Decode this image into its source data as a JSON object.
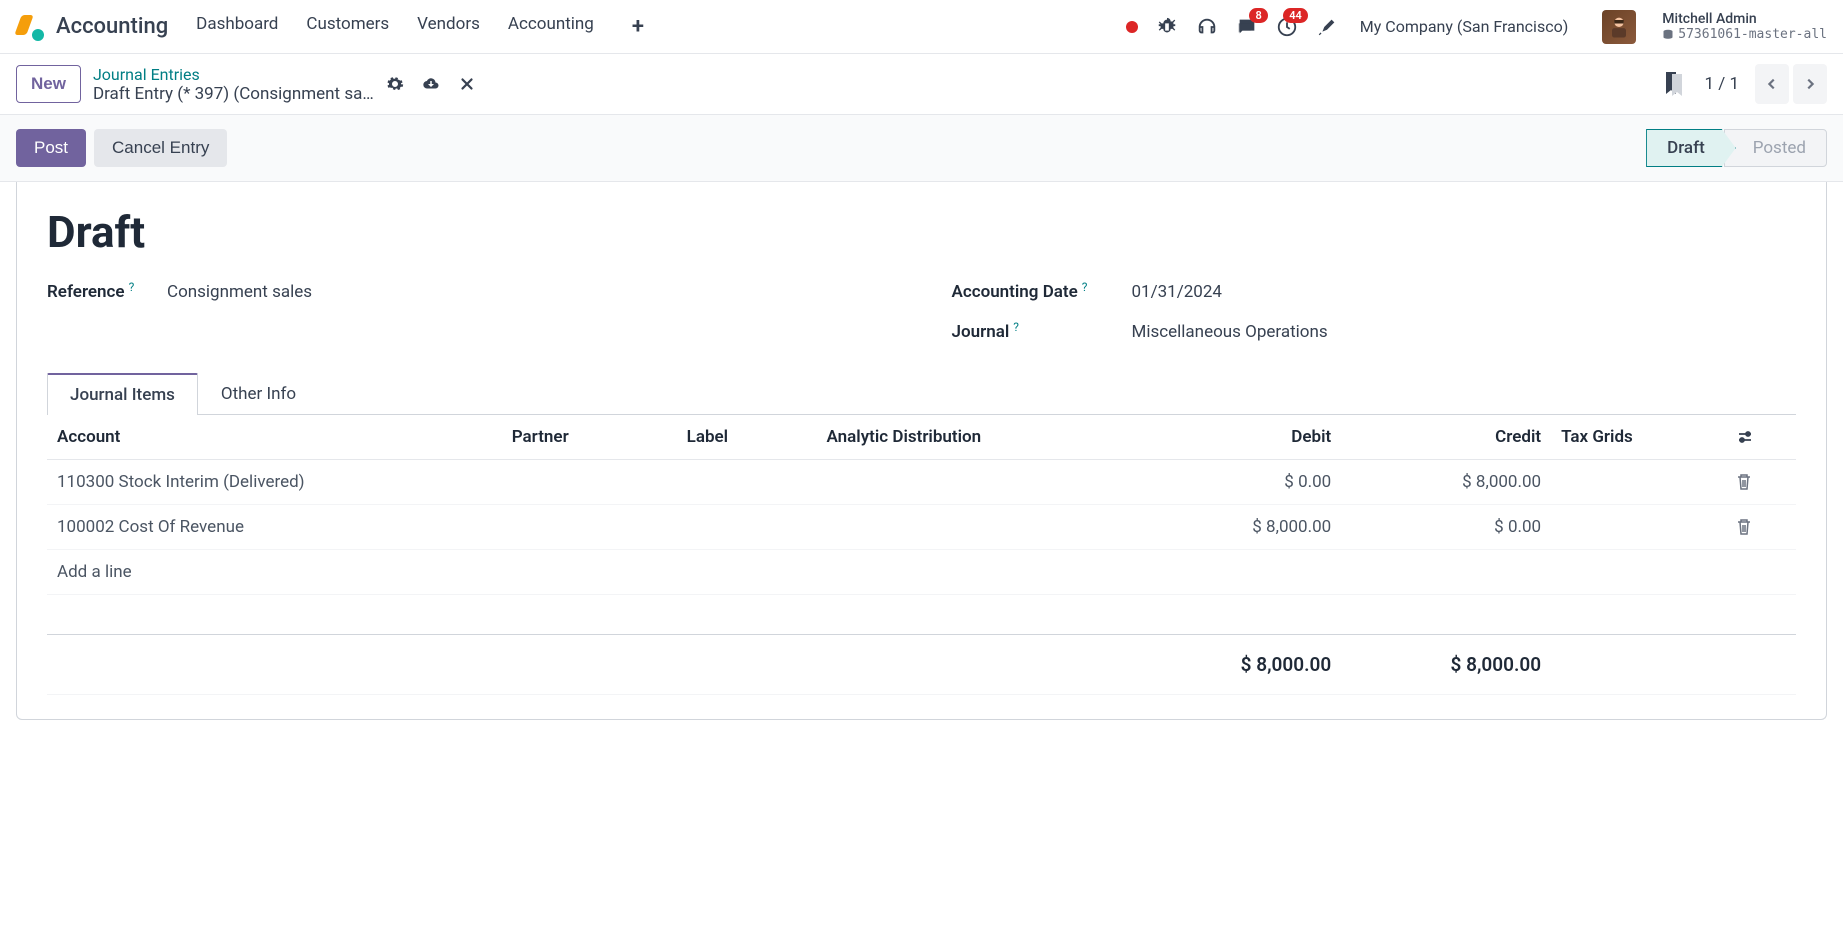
{
  "app_title": "Accounting",
  "nav": {
    "items": [
      "Dashboard",
      "Customers",
      "Vendors",
      "Accounting"
    ]
  },
  "header": {
    "message_badge": "8",
    "activity_badge": "44",
    "company": "My Company (San Francisco)",
    "user_name": "Mitchell Admin",
    "db_name": "57361061-master-all"
  },
  "breadcrumb": {
    "new_label": "New",
    "parent": "Journal Entries",
    "current": "Draft Entry (* 397) (Consignment sa…"
  },
  "pager": {
    "text": "1 / 1"
  },
  "actions": {
    "post": "Post",
    "cancel": "Cancel Entry"
  },
  "status": {
    "draft": "Draft",
    "posted": "Posted"
  },
  "form": {
    "heading": "Draft",
    "reference_label": "Reference",
    "reference_value": "Consignment sales",
    "date_label": "Accounting Date",
    "date_value": "01/31/2024",
    "journal_label": "Journal",
    "journal_value": "Miscellaneous Operations"
  },
  "tabs": {
    "journal_items": "Journal Items",
    "other_info": "Other Info"
  },
  "table": {
    "columns": {
      "account": "Account",
      "partner": "Partner",
      "label": "Label",
      "analytic": "Analytic Distribution",
      "debit": "Debit",
      "credit": "Credit",
      "tax_grids": "Tax Grids"
    },
    "rows": [
      {
        "account": "110300 Stock Interim (Delivered)",
        "partner": "",
        "label": "",
        "analytic": "",
        "debit": "$ 0.00",
        "credit": "$ 8,000.00",
        "tax_grids": ""
      },
      {
        "account": "100002 Cost Of Revenue",
        "partner": "",
        "label": "",
        "analytic": "",
        "debit": "$ 8,000.00",
        "credit": "$ 0.00",
        "tax_grids": ""
      }
    ],
    "add_line": "Add a line",
    "totals": {
      "debit": "$ 8,000.00",
      "credit": "$ 8,000.00"
    }
  }
}
